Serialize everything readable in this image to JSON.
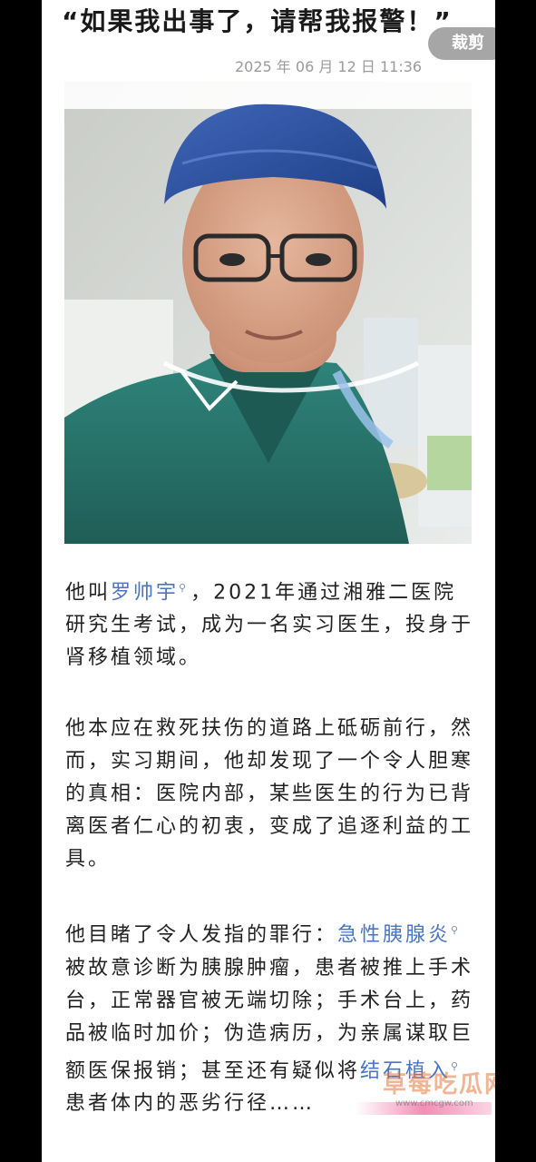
{
  "header": {
    "title": "“如果我出事了，请帮我报警！”",
    "date": "2025 年 06 月 12 日 11:36",
    "crop_label": "裁剪"
  },
  "body": {
    "p1": {
      "before": "他叫",
      "link": "罗帅宇",
      "after": "，2021年通过湘雅二医院研究生考试，成为一名实习医生，投身于肾移植领域。"
    },
    "p2": "他本应在救死扶伤的道路上砥砺前行，然而，实习期间，他却发现了一个令人胆寒的真相：医院内部，某些医生的行为已背离医者仁心的初衷，变成了追逐利益的工具。",
    "p3": {
      "before": "他目睹了令人发指的罪行：",
      "link1": "急性胰腺炎",
      "middle": "被故意诊断为胰腺肿瘤，患者被推上手术台，正常器官被无端切除；手术台上，药品被临时加价；伪造病历，为亲属谋取巨额医保报销；甚至还有疑似将",
      "link2": "结石植入",
      "after": "患者体内的恶劣行径……"
    }
  },
  "watermark": {
    "main": "草莓吃瓜网",
    "url": "www.cmcgw.com"
  },
  "colors": {
    "link": "#4a74c4",
    "scrub_color": "#2a7a72",
    "cap_color": "#2a4f9c"
  }
}
